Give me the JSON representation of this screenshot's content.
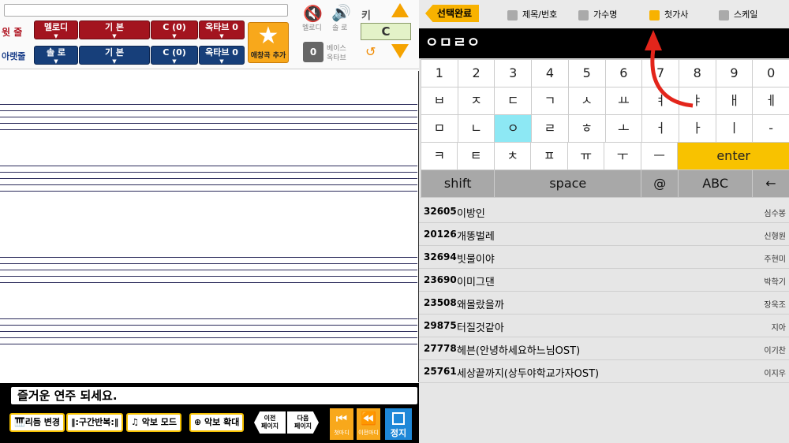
{
  "left": {
    "upper_label": "윗 줄",
    "lower_label": "아랫줄",
    "upper_controls": [
      "멜로디",
      "기 본",
      "C (0)",
      "옥타브 0"
    ],
    "lower_controls": [
      "솔 로",
      "기 본",
      "C (0)",
      "옥타브 0"
    ],
    "fav_button": "애창곡 추가",
    "melody_label": "멜로디",
    "solo_label": "솔 로",
    "key_label": "키",
    "key_value": "C",
    "bass_value": "0",
    "bass_label_1": "베이스",
    "bass_label_2": "옥타브",
    "message": "즐거운 연주 되세요.",
    "buttons": [
      "리듬 변경",
      "구간반복",
      "악보 모드",
      "악보 확대"
    ],
    "prev_page": [
      "이전",
      "페이지"
    ],
    "next_page": [
      "다음",
      "페이지"
    ],
    "first_bar": "첫마디",
    "prev_bar": "이전마디",
    "stop": "정지"
  },
  "right": {
    "done_button": "선택완료",
    "filters": [
      {
        "label": "제목/번호",
        "checked": false
      },
      {
        "label": "가수명",
        "checked": false
      },
      {
        "label": "첫가사",
        "checked": true
      },
      {
        "label": "스케일",
        "checked": false
      }
    ],
    "search_text": "ㅇㅁㄹㅇ",
    "keyboard": {
      "row1": [
        "1",
        "2",
        "3",
        "4",
        "5",
        "6",
        "7",
        "8",
        "9",
        "0"
      ],
      "row2": [
        "ㅂ",
        "ㅈ",
        "ㄷ",
        "ㄱ",
        "ㅅ",
        "ㅛ",
        "ㅕ",
        "ㅑ",
        "ㅐ",
        "ㅔ"
      ],
      "row3": [
        "ㅁ",
        "ㄴ",
        "ㅇ",
        "ㄹ",
        "ㅎ",
        "ㅗ",
        "ㅓ",
        "ㅏ",
        "ㅣ",
        "-"
      ],
      "row4": [
        "ㅋ",
        "ㅌ",
        "ㅊ",
        "ㅍ",
        "ㅠ",
        "ㅜ",
        "ㅡ"
      ],
      "enter": "enter",
      "shift": "shift",
      "space": "space",
      "at": "@",
      "abc": "ABC",
      "backspace": "←"
    },
    "songs": [
      {
        "no": "32605",
        "title": "이방인",
        "artist": "심수봉"
      },
      {
        "no": "20126",
        "title": "개똥벌레",
        "artist": "신형원"
      },
      {
        "no": "32694",
        "title": "빗물이야",
        "artist": "주현미"
      },
      {
        "no": "23690",
        "title": "이미그댄",
        "artist": "박학기"
      },
      {
        "no": "23508",
        "title": "왜몰랐을까",
        "artist": "장욱조"
      },
      {
        "no": "29875",
        "title": "터질것같아",
        "artist": "지아"
      },
      {
        "no": "27778",
        "title": "헤븐(안녕하세요하느님OST)",
        "artist": "이기찬"
      },
      {
        "no": "25761",
        "title": "세상끝까지(상두야학교가자OST)",
        "artist": "이지우"
      }
    ]
  },
  "colors": {
    "accent": "#f8b200",
    "upper": "#a3141f",
    "lower": "#173f7a",
    "arrow": "#e3251b"
  },
  "icons": [
    "mute-speaker-icon",
    "speaker-icon",
    "star-icon",
    "reset-icon",
    "keyboard-icon",
    "repeat-icon",
    "music-note-icon",
    "zoom-icon",
    "first-bar-icon",
    "prev-bar-icon",
    "stop-icon"
  ]
}
